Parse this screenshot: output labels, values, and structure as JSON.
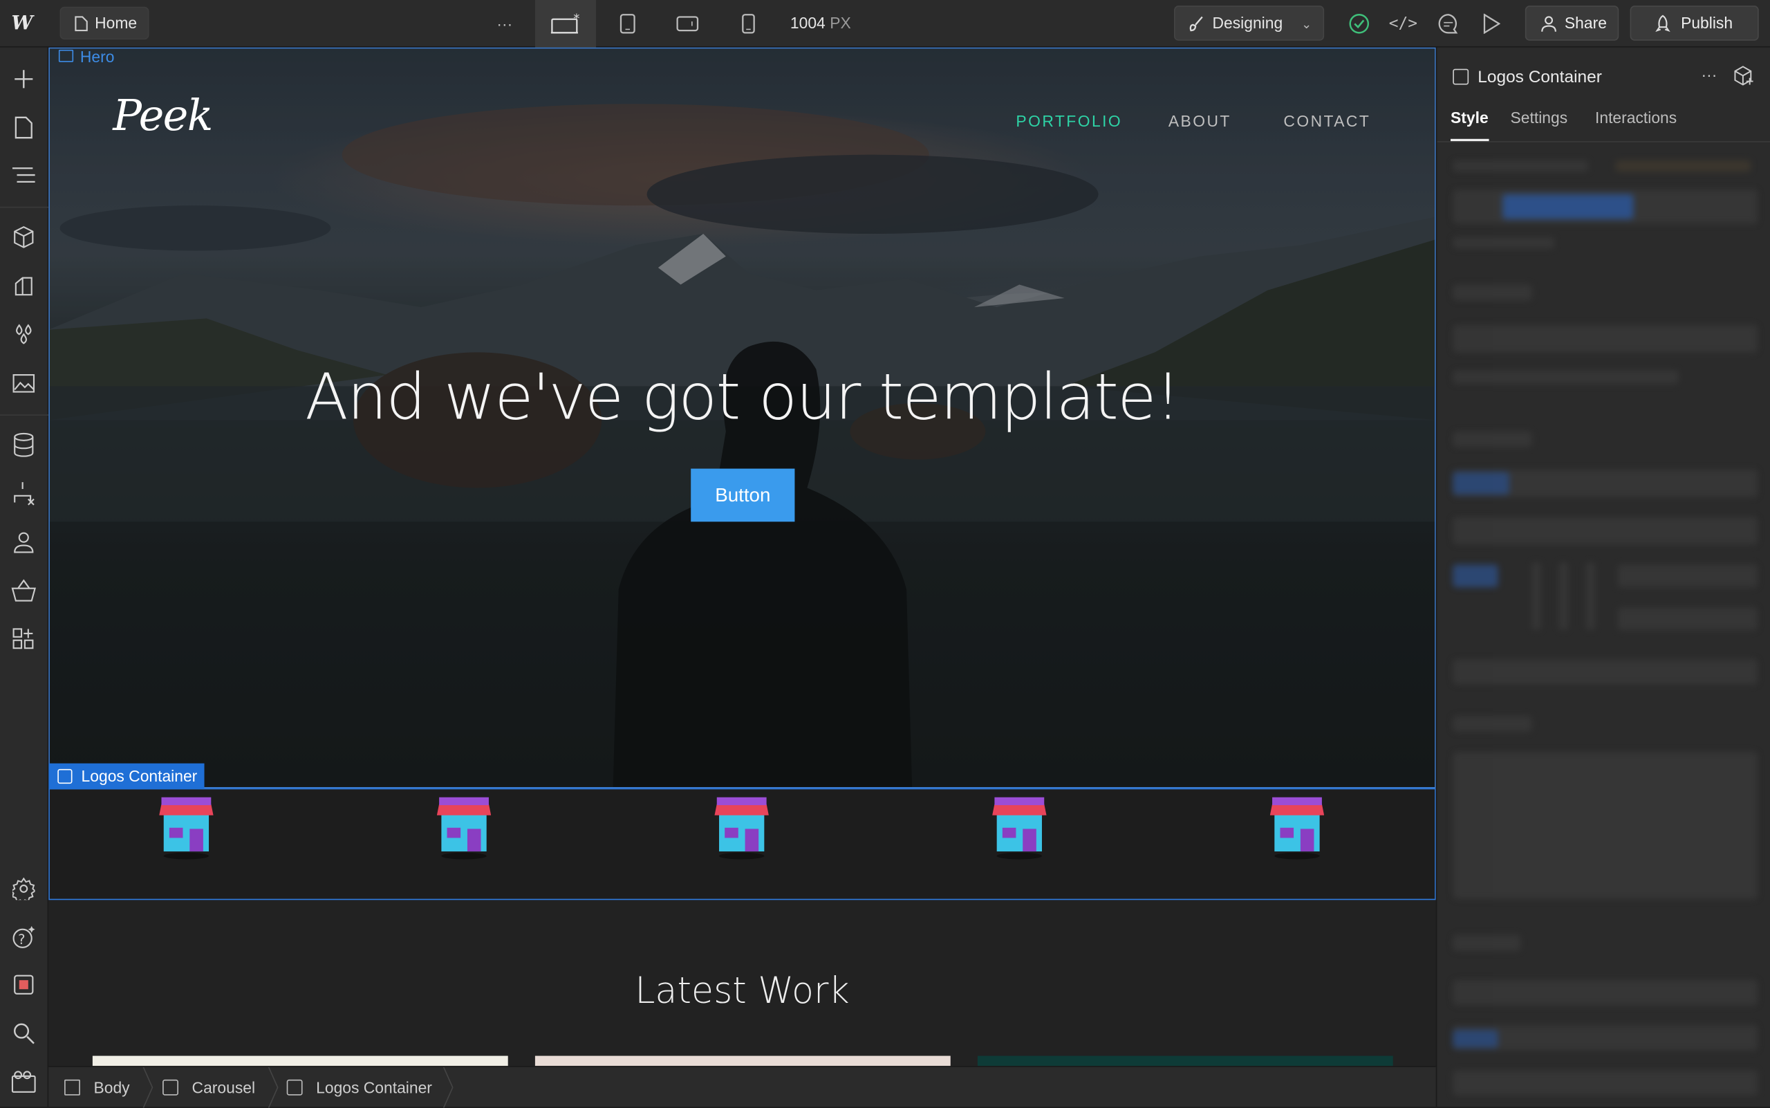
{
  "topbar": {
    "page_name": "Home",
    "more": "···",
    "width_value": "1004",
    "width_unit": "PX",
    "mode_label": "Designing",
    "share_label": "Share",
    "publish_label": "Publish"
  },
  "hero": {
    "element_label": "Hero",
    "logo_text": "Peek",
    "nav": [
      {
        "label": "PORTFOLIO",
        "color": "#2ed3a6"
      },
      {
        "label": "ABOUT",
        "color": "#bfbfbf"
      },
      {
        "label": "CONTACT",
        "color": "#bfbfbf"
      }
    ],
    "title": "And we've got our template!",
    "button_label": "Button"
  },
  "logos": {
    "element_label": "Logos Container",
    "count": 5
  },
  "latest_work": {
    "title": "Latest Work"
  },
  "breadcrumbs": [
    "Body",
    "Carousel",
    "Logos Container"
  ],
  "right_panel": {
    "title": "Logos Container",
    "more": "···",
    "tabs": [
      "Style",
      "Settings",
      "Interactions"
    ],
    "active_tab": "Style"
  },
  "colors": {
    "accent_blue": "#3a9bed",
    "selection_blue": "#1f6fd6",
    "nav_active": "#2ed3a6"
  }
}
